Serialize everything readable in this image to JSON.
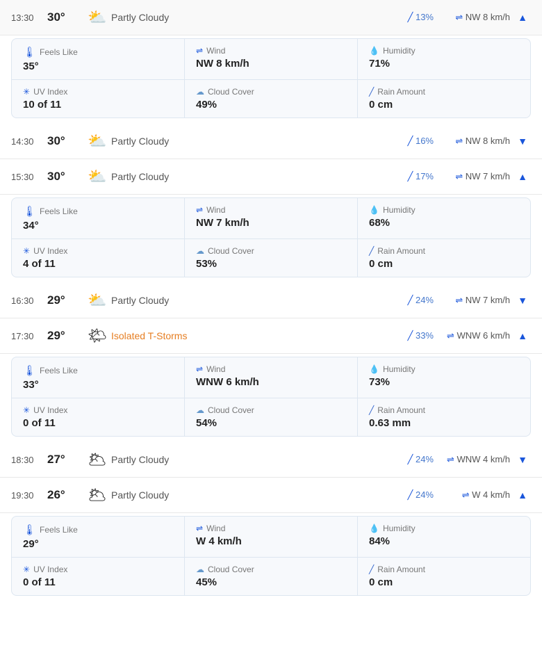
{
  "forecasts": [
    {
      "time": "13:30",
      "temp": "30°",
      "icon": "⛅",
      "condition": "Partly Cloudy",
      "condition_color": "normal",
      "rain_pct": "13%",
      "wind": "NW 8 km/h",
      "chevron": "▲",
      "expanded": true,
      "details": {
        "feels_like": "35°",
        "wind": "NW 8 km/h",
        "humidity": "71%",
        "uv_index": "10 of 11",
        "cloud_cover": "49%",
        "rain_amount": "0 cm"
      }
    },
    {
      "time": "14:30",
      "temp": "30°",
      "icon": "⛅",
      "condition": "Partly Cloudy",
      "condition_color": "normal",
      "rain_pct": "16%",
      "wind": "NW 8 km/h",
      "chevron": "▼",
      "expanded": false,
      "details": null
    },
    {
      "time": "15:30",
      "temp": "30°",
      "icon": "⛅",
      "condition": "Partly Cloudy",
      "condition_color": "normal",
      "rain_pct": "17%",
      "wind": "NW 7 km/h",
      "chevron": "▲",
      "expanded": true,
      "details": {
        "feels_like": "34°",
        "wind": "NW 7 km/h",
        "humidity": "68%",
        "uv_index": "4 of 11",
        "cloud_cover": "53%",
        "rain_amount": "0 cm"
      }
    },
    {
      "time": "16:30",
      "temp": "29°",
      "icon": "⛅",
      "condition": "Partly Cloudy",
      "condition_color": "normal",
      "rain_pct": "24%",
      "wind": "NW 7 km/h",
      "chevron": "▼",
      "expanded": false,
      "details": null
    },
    {
      "time": "17:30",
      "temp": "29°",
      "icon": "🌤",
      "condition": "Isolated T-Storms",
      "condition_color": "orange",
      "rain_pct": "33%",
      "wind": "WNW 6 km/h",
      "chevron": "▲",
      "expanded": true,
      "details": {
        "feels_like": "33°",
        "wind": "WNW 6 km/h",
        "humidity": "73%",
        "uv_index": "0 of 11",
        "cloud_cover": "54%",
        "rain_amount": "0.63 mm"
      }
    },
    {
      "time": "18:30",
      "temp": "27°",
      "icon": "🌥",
      "condition": "Partly Cloudy",
      "condition_color": "normal",
      "rain_pct": "24%",
      "wind": "WNW 4 km/h",
      "chevron": "▼",
      "expanded": false,
      "details": null
    },
    {
      "time": "19:30",
      "temp": "26°",
      "icon": "🌥",
      "condition": "Partly Cloudy",
      "condition_color": "normal",
      "rain_pct": "24%",
      "wind": "W 4 km/h",
      "chevron": "▲",
      "expanded": true,
      "details": {
        "feels_like": "29°",
        "wind": "W 4 km/h",
        "humidity": "84%",
        "uv_index": "0 of 11",
        "cloud_cover": "45%",
        "rain_amount": "0 cm"
      }
    }
  ],
  "labels": {
    "feels_like": "Feels Like",
    "wind": "Wind",
    "humidity": "Humidity",
    "uv_index": "UV Index",
    "cloud_cover": "Cloud Cover",
    "rain_amount": "Rain Amount"
  }
}
